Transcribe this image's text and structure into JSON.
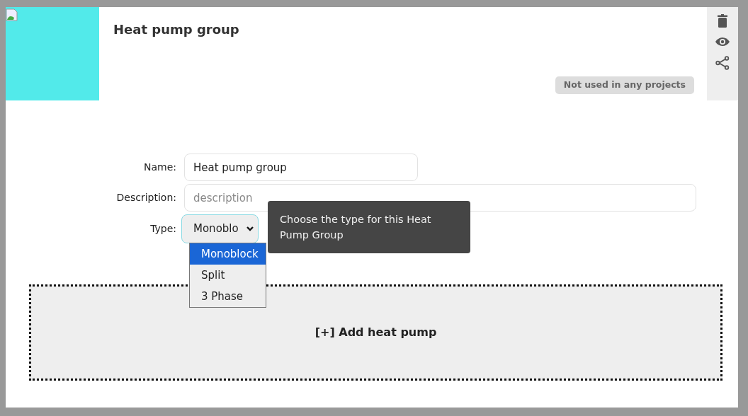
{
  "header": {
    "title": "Heat pump group",
    "usage_badge": "Not used in any projects"
  },
  "toolbar": [
    {
      "kind": "delete"
    },
    {
      "kind": "view"
    },
    {
      "kind": "share"
    }
  ],
  "form": {
    "name": {
      "label": "Name:",
      "value": "Heat pump group"
    },
    "description": {
      "label": "Description:",
      "placeholder": "description"
    },
    "type": {
      "label": "Type:",
      "value": "Monoblo",
      "expanded": true,
      "options": [
        {
          "label": "Monoblock",
          "selected": true
        },
        {
          "label": "Split",
          "selected": false
        },
        {
          "label": "3 Phase",
          "selected": false
        }
      ]
    },
    "tooltip": "Choose the type for this Heat Pump Group"
  },
  "add_button": "[+] Add heat pump"
}
